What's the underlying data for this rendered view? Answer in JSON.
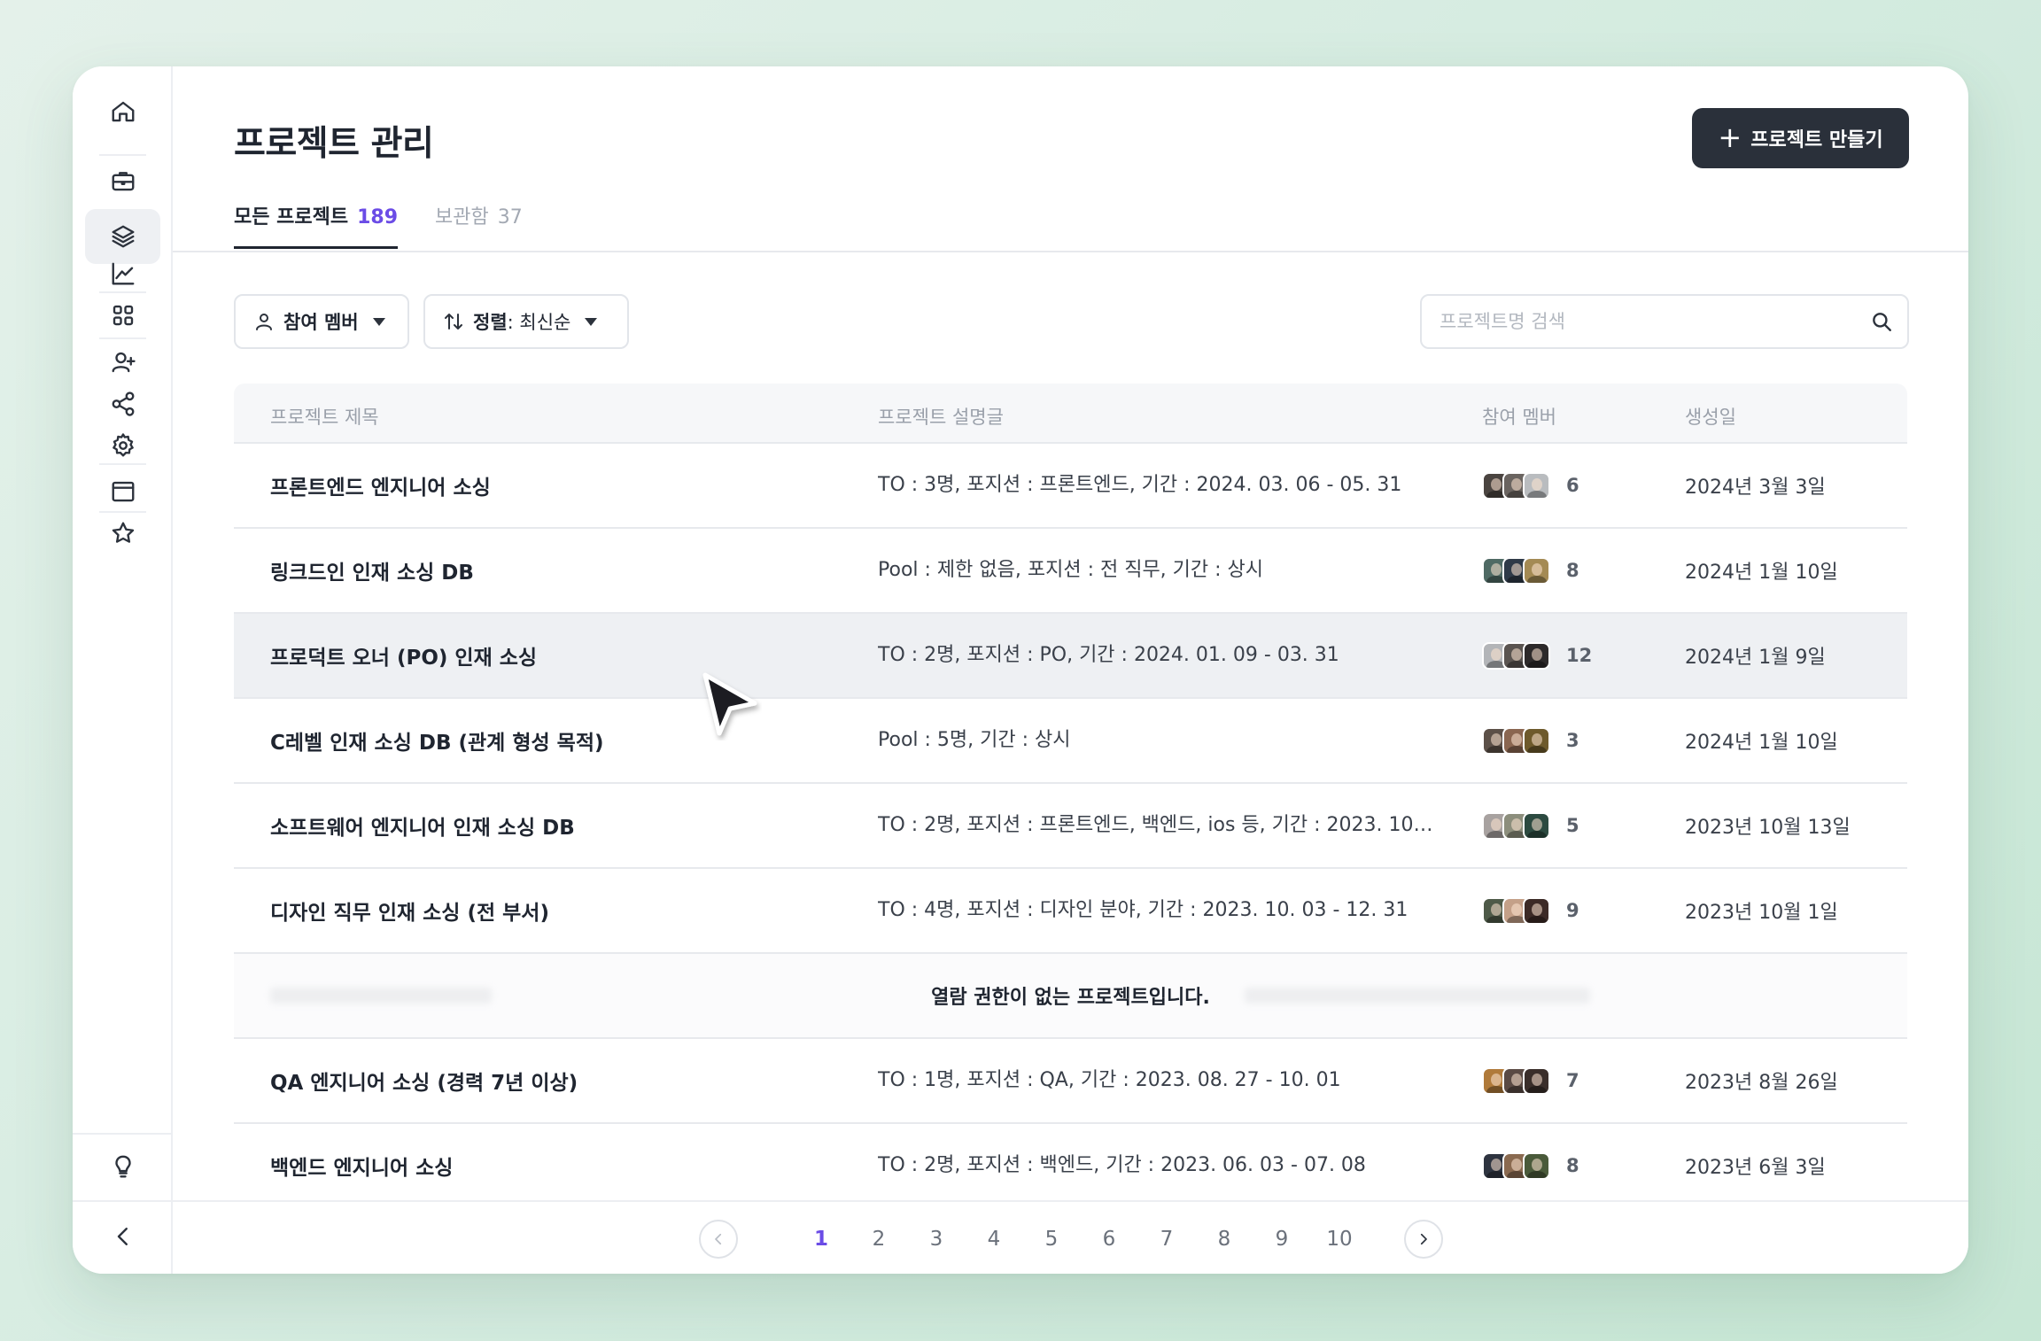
{
  "page": {
    "title": "프로젝트 관리",
    "create_button": "프로젝트 만들기"
  },
  "tabs": [
    {
      "label": "모든 프로젝트",
      "count": "189",
      "active": true
    },
    {
      "label": "보관함",
      "count": "37",
      "active": false
    }
  ],
  "filters": {
    "member_label": "참여 멤버",
    "sort_label": "정렬",
    "sort_value": ": 최신순"
  },
  "search": {
    "placeholder": "프로젝트명 검색"
  },
  "table": {
    "headers": {
      "title": "프로젝트 제목",
      "description": "프로젝트 설명글",
      "members": "참여 멤버",
      "created": "생성일"
    },
    "rows": [
      {
        "title": "프론트엔드 엔지니어 소싱",
        "description": "TO : 3명, 포지션 : 프론트엔드, 기간 : 2024. 03. 06 - 05. 31",
        "members": "6",
        "created": "2024년 3월 3일"
      },
      {
        "title": "링크드인 인재 소싱 DB",
        "description": "Pool : 제한 없음, 포지션 : 전 직무, 기간 : 상시",
        "members": "8",
        "created": "2024년 1월 10일"
      },
      {
        "title": "프로덕트 오너 (PO) 인재 소싱",
        "description": "TO : 2명, 포지션 : PO, 기간 : 2024. 01. 09 - 03. 31",
        "members": "12",
        "created": "2024년 1월 9일"
      },
      {
        "title": "C레벨 인재 소싱 DB (관계 형성 목적)",
        "description": "Pool : 5명, 기간 : 상시",
        "members": "3",
        "created": "2024년 1월 10일"
      },
      {
        "title": "소프트웨어 엔지니어 인재 소싱 DB",
        "description": "TO : 2명, 포지션 : 프론트엔드, 백엔드, ios 등, 기간 : 2023. 10. 1...",
        "members": "5",
        "created": "2023년 10월 13일"
      },
      {
        "title": "디자인 직무 인재 소싱 (전 부서)",
        "description": "TO : 4명, 포지션 : 디자인 분야, 기간 : 2023. 10. 03 - 12. 31",
        "members": "9",
        "created": "2023년 10월 1일"
      },
      {
        "title": "QA 엔지니어 소싱 (경력 7년 이상)",
        "description": "TO : 1명, 포지션 : QA, 기간 : 2023. 08. 27 - 10. 01",
        "members": "7",
        "created": "2023년 8월 26일"
      },
      {
        "title": "백엔드 엔지니어 소싱",
        "description": "TO : 2명, 포지션 : 백엔드, 기간 : 2023. 06. 03 - 07. 08",
        "members": "8",
        "created": "2023년 6월 3일"
      }
    ],
    "restricted_message": "열람 권한이 없는 프로젝트입니다."
  },
  "pagination": {
    "pages": [
      "1",
      "2",
      "3",
      "4",
      "5",
      "6",
      "7",
      "8",
      "9",
      "10"
    ],
    "current": "1"
  },
  "colors": {
    "accent": "#6b4ce6",
    "dark_button": "#2a303a",
    "hover_row": "#eef0f3"
  },
  "icons": {
    "sidebar": [
      "home-icon",
      "briefcase-icon",
      "layers-icon",
      "chart-icon",
      "grid-icon",
      "user-plus-icon",
      "share-icon",
      "gear-icon",
      "window-icon",
      "star-icon",
      "lightbulb-icon",
      "chevron-left-icon"
    ]
  }
}
